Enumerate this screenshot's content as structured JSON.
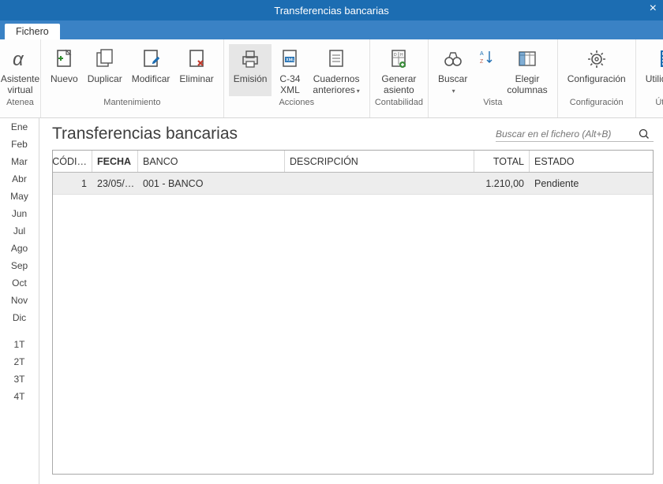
{
  "window": {
    "title": "Transferencias bancarias"
  },
  "tabs": {
    "fichero": "Fichero"
  },
  "ribbon": {
    "assistant": {
      "label": "Asistente\nvirtual",
      "caption": "Atenea"
    },
    "maintenance": {
      "nuevo": "Nuevo",
      "duplicar": "Duplicar",
      "modificar": "Modificar",
      "eliminar": "Eliminar",
      "caption": "Mantenimiento"
    },
    "actions": {
      "emision": "Emisión",
      "c34": "C-34\nXML",
      "cuadernos": "Cuadernos\nanteriores",
      "caption": "Acciones"
    },
    "contabilidad": {
      "generar": "Generar\nasiento",
      "caption": "Contabilidad"
    },
    "vista": {
      "buscar": "Buscar",
      "sort": "",
      "elegir": "Elegir\ncolumnas",
      "caption": "Vista"
    },
    "config": {
      "config": "Configuración",
      "caption": "Configuración"
    },
    "utiles": {
      "util": "Utilidades",
      "caption": "Útiles"
    }
  },
  "sidebar": {
    "months": [
      "Ene",
      "Feb",
      "Mar",
      "Abr",
      "May",
      "Jun",
      "Jul",
      "Ago",
      "Sep",
      "Oct",
      "Nov",
      "Dic"
    ],
    "quarters": [
      "1T",
      "2T",
      "3T",
      "4T"
    ]
  },
  "main": {
    "heading": "Transferencias bancarias",
    "search_placeholder": "Buscar en el fichero (Alt+B)"
  },
  "grid": {
    "cols": {
      "cod": "CÓDI…",
      "fecha": "FECHA",
      "banco": "BANCO",
      "desc": "DESCRIPCIÓN",
      "total": "TOTAL",
      "estado": "ESTADO"
    },
    "rows": [
      {
        "cod": "1",
        "fecha": "23/05/…",
        "banco": "001 - BANCO",
        "desc": "",
        "total": "1.210,00",
        "estado": "Pendiente"
      }
    ]
  }
}
